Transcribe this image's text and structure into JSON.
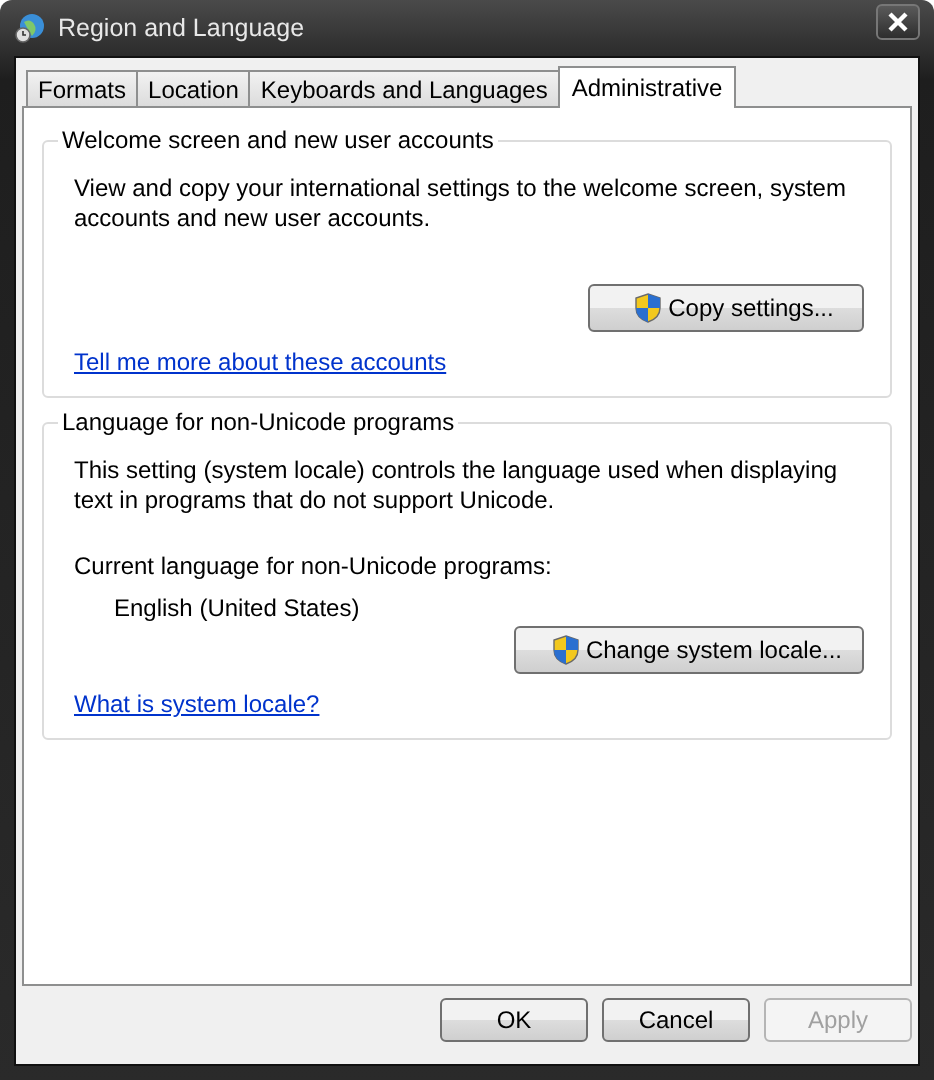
{
  "window": {
    "title": "Region and Language"
  },
  "tabs": [
    {
      "label": "Formats",
      "selected": false
    },
    {
      "label": "Location",
      "selected": false
    },
    {
      "label": "Keyboards and Languages",
      "selected": false
    },
    {
      "label": "Administrative",
      "selected": true
    }
  ],
  "groups": [
    {
      "title": "Welcome screen and new user accounts",
      "items": [
        {
          "kind": "paragraph",
          "text": "View and copy your international settings to the welcome screen, system accounts and new user accounts."
        },
        {
          "kind": "button",
          "label": "Copy settings...",
          "shield": true
        },
        {
          "kind": "link",
          "text": "Tell me more about these accounts"
        }
      ]
    },
    {
      "title": "Language for non-Unicode programs",
      "items": [
        {
          "kind": "paragraph",
          "text": "This setting (system locale) controls the language used when displaying text in programs that do not support Unicode."
        },
        {
          "kind": "label",
          "text": "Current language for non-Unicode programs:"
        },
        {
          "kind": "value",
          "text": "English (United States)"
        },
        {
          "kind": "button",
          "label": "Change system locale...",
          "shield": true
        },
        {
          "kind": "link",
          "text": "What is system locale?"
        }
      ]
    }
  ],
  "buttons": [
    {
      "label": "OK",
      "disabled": false
    },
    {
      "label": "Cancel",
      "disabled": false
    },
    {
      "label": "Apply",
      "disabled": true
    }
  ]
}
